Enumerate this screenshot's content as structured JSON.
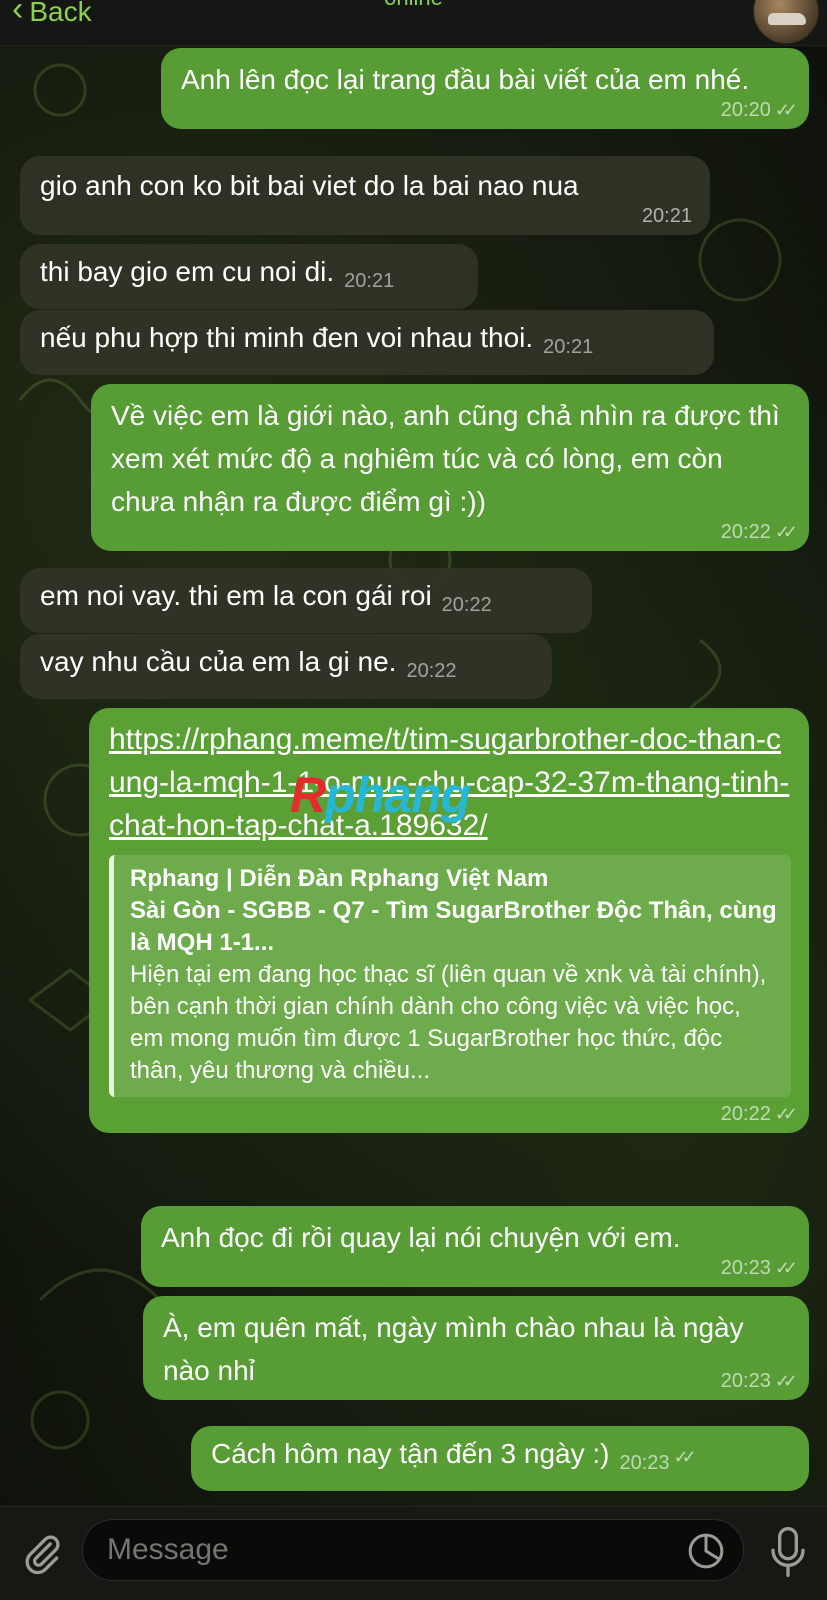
{
  "header": {
    "back_label": "Back",
    "contact_name": "",
    "status": "online"
  },
  "messages": [
    {
      "dir": "out",
      "text": "Anh lên đọc lại trang đầu bài viết của em nhé.",
      "time": "20:20",
      "ticks": "✓✓"
    },
    {
      "dir": "in",
      "text": "gio anh con ko bit bai viet do la bai nao nua",
      "time": "20:21"
    },
    {
      "dir": "in",
      "text": "thi bay gio em cu noi di.",
      "time": "20:21"
    },
    {
      "dir": "in",
      "text": "nếu phu hợp thi minh đen voi nhau thoi.",
      "time": "20:21"
    },
    {
      "dir": "out",
      "text": "Về việc em là giới nào, anh cũng chả nhìn ra được thì xem xét mức độ a nghiêm túc và có lòng, em còn chưa nhận ra được điểm gì :))",
      "time": "20:22",
      "ticks": "✓✓"
    },
    {
      "dir": "in",
      "text": "em noi vay. thi em la con gái roi",
      "time": "20:22"
    },
    {
      "dir": "in",
      "text": "vay nhu cầu của em la gi ne.",
      "time": "20:22"
    },
    {
      "dir": "out",
      "link": "https://rphang.meme/t/tim-sugarbrother-doc-than-cung-la-mqh-1-1-o-muc-chu-cap-32-37m-thang-tinh-chat-hon-tap-chat-a.189632/",
      "preview_site": "Rphang | Diễn Đàn Rphang Việt Nam",
      "preview_title": "Sài Gòn - SGBB - Q7 - Tìm SugarBrother Độc Thân, cùng là MQH 1-1...",
      "preview_desc": "Hiện tại em đang học thạc sĩ (liên quan về xnk và tài chính), bên cạnh thời gian chính dành cho công việc và việc học, em mong muốn tìm được 1 SugarBrother học thức, độc thân, yêu thương và chiều...",
      "time": "20:22",
      "ticks": "✓✓"
    },
    {
      "dir": "out",
      "text": "Anh đọc đi rồi quay lại nói chuyện với em.",
      "time": "20:23",
      "ticks": "✓✓"
    },
    {
      "dir": "out",
      "text": "À, em quên mất, ngày mình chào nhau là ngày nào nhỉ",
      "time": "20:23",
      "ticks": "✓✓"
    },
    {
      "dir": "out",
      "text": "Cách hôm nay tận đến 3 ngày :)",
      "time": "20:23",
      "ticks": "✓✓"
    }
  ],
  "watermark": {
    "r": "R",
    "rest": "phang"
  },
  "input": {
    "placeholder": "Message"
  }
}
